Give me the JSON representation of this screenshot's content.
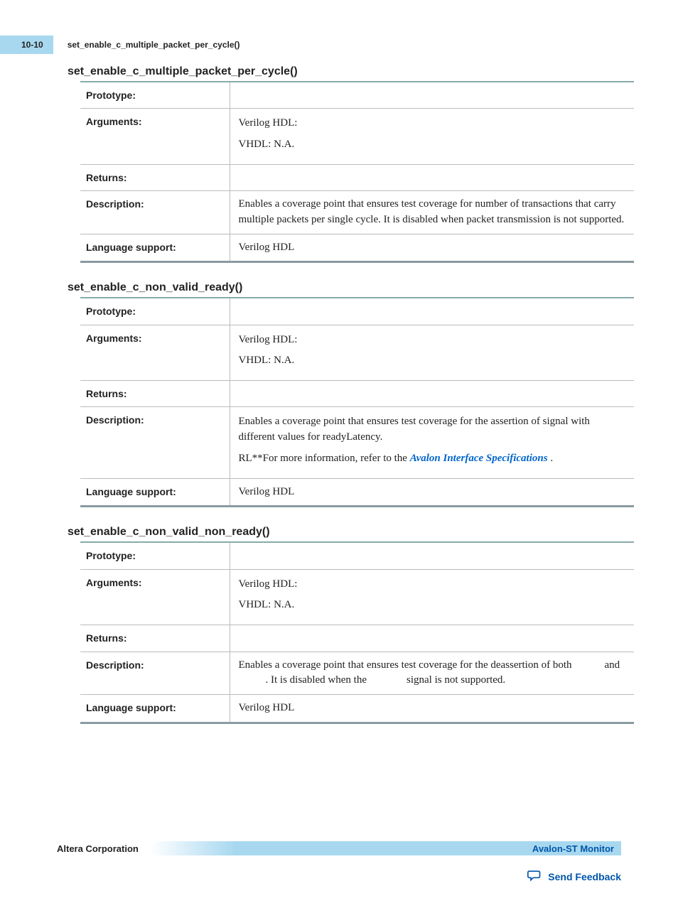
{
  "header": {
    "page_number": "10-10",
    "running_title": "set_enable_c_multiple_packet_per_cycle()"
  },
  "sections": [
    {
      "heading": "set_enable_c_multiple_packet_per_cycle()",
      "rows": {
        "prototype_label": "Prototype:",
        "prototype_value": "",
        "arguments_label": "Arguments:",
        "arguments_line1": "Verilog HDL:",
        "arguments_line2": "VHDL: N.A.",
        "returns_label": "Returns:",
        "returns_value": "",
        "description_label": "Description:",
        "description_value": "Enables a coverage point that ensures test coverage for number of transactions that carry multiple packets per single cycle. It is disabled when packet transmission is not supported.",
        "language_label": "Language support:",
        "language_value": "Verilog HDL"
      }
    },
    {
      "heading": "set_enable_c_non_valid_ready()",
      "rows": {
        "prototype_label": "Prototype:",
        "prototype_value": "",
        "arguments_label": "Arguments:",
        "arguments_line1": "Verilog HDL:",
        "arguments_line2": "VHDL: N.A.",
        "returns_label": "Returns:",
        "returns_value": "",
        "description_label": "Description:",
        "description_p1": "Enables a coverage point that ensures test coverage for the assertion of signal with different values for readyLatency.",
        "description_p2a": "RL**For more information, refer to the ",
        "description_link": "Avalon Interface Specifications",
        "description_p2b": " .",
        "language_label": "Language support:",
        "language_value": "Verilog HDL"
      }
    },
    {
      "heading": "set_enable_c_non_valid_non_ready()",
      "rows": {
        "prototype_label": "Prototype:",
        "prototype_value": "",
        "arguments_label": "Arguments:",
        "arguments_line1": "Verilog HDL:",
        "arguments_line2": "VHDL: N.A.",
        "returns_label": "Returns:",
        "returns_value": "",
        "description_label": "Description:",
        "description_a": "Enables a coverage point that ensures test coverage for the deassertion of both",
        "description_b": "and",
        "description_c": ". It is disabled when the",
        "description_d": "signal is not supported.",
        "language_label": "Language support:",
        "language_value": "Verilog HDL"
      }
    }
  ],
  "footer": {
    "left": "Altera Corporation",
    "right": "Avalon-ST Monitor",
    "feedback": "Send Feedback"
  }
}
